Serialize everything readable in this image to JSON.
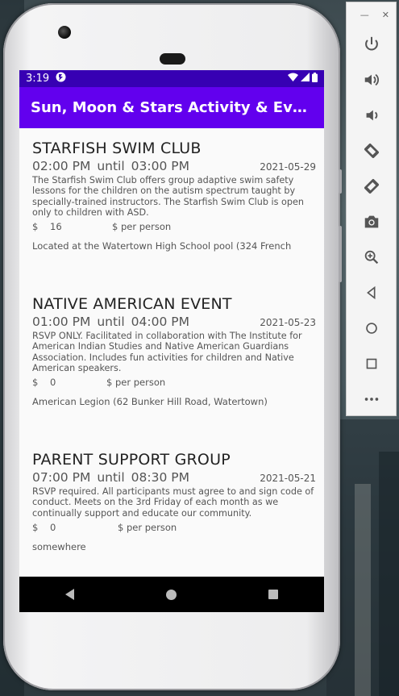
{
  "status_bar": {
    "time": "3:19"
  },
  "app_bar": {
    "title": "Sun, Moon & Stars Activity & Event Calendar"
  },
  "events": [
    {
      "title": "STARFISH SWIM CLUB",
      "start": "02:00 PM",
      "until": "until",
      "end": "03:00 PM",
      "date": "2021-05-29",
      "description": "The Starfish Swim Club offers group adaptive swim safety lessons for the children on the autism spectrum taught by specially-trained instructors. The Starfish Swim Club is open only to children with ASD.",
      "currency": "$",
      "price": "16",
      "per_label": "$  per person",
      "location": "Located at the Watertown High School pool (324 French"
    },
    {
      "title": "NATIVE AMERICAN EVENT",
      "start": "01:00 PM",
      "until": "until",
      "end": "04:00 PM",
      "date": "2021-05-23",
      "description": "RSVP ONLY. Facilitated in collaboration with The Institute for American Indian Studies and Native American Guardians Association. Includes fun activities for children and Native American speakers.",
      "currency": "$",
      "price": "0",
      "per_label": "$  per person",
      "location": "American Legion (62 Bunker Hill Road, Watertown)"
    },
    {
      "title": "PARENT SUPPORT GROUP",
      "start": "07:00 PM",
      "until": "until",
      "end": "08:30 PM",
      "date": "2021-05-21",
      "description": "RSVP required. All participants must agree to and sign code of conduct. Meets on the 3rd Friday of each month as we continually support and educate our community.",
      "currency": "$",
      "price": "0",
      "per_label": "$  per person",
      "location": "somewhere"
    }
  ],
  "colors": {
    "status_bar": "#3700b3",
    "app_bar": "#6200ee",
    "nav_bar": "#000000"
  },
  "emulator_panel": {
    "icons": [
      "power-icon",
      "volume-up-icon",
      "volume-down-icon",
      "rotate-left-icon",
      "rotate-right-icon",
      "camera-icon",
      "zoom-icon",
      "back-icon",
      "home-icon",
      "overview-icon",
      "more-icon"
    ]
  }
}
